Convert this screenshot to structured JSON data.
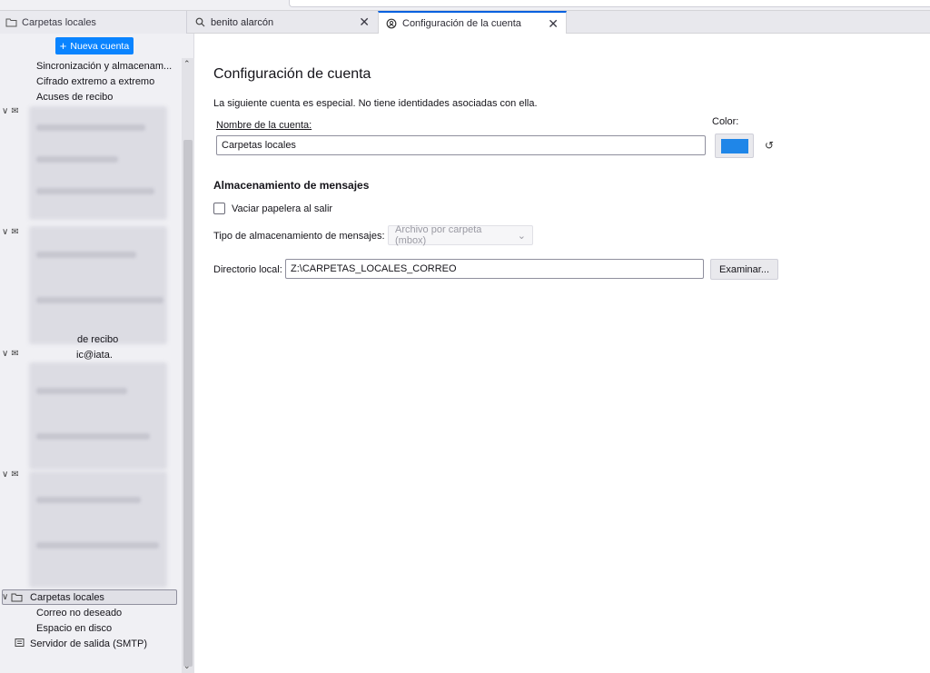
{
  "tabs": {
    "folder_pane_title": "Carpetas locales",
    "search_tab": "benito alarcón",
    "settings_tab": "Configuración de la cuenta"
  },
  "sidebar": {
    "new_account": "Nueva cuenta",
    "top_items": [
      "Sincronización y almacenam...",
      "Cifrado extremo a extremo",
      "Acuses de recibo"
    ],
    "partial_visible": [
      "de recibo",
      "ic@iata."
    ],
    "local_folders": "Carpetas locales",
    "local_children": [
      "Correo no deseado",
      "Espacio en disco"
    ],
    "smtp": "Servidor de salida (SMTP)"
  },
  "main": {
    "title": "Configuración de cuenta",
    "note": "La siguiente cuenta es especial. No tiene identidades asociadas con ella.",
    "account_name_label": "Nombre de la cuenta:",
    "account_name_value": "Carpetas locales",
    "color_label": "Color:",
    "color_value": "#1f86e8",
    "storage_heading": "Almacenamiento de mensajes",
    "empty_trash_label": "Vaciar papelera al salir",
    "storage_type_label": "Tipo de almacenamiento de mensajes:",
    "storage_type_value": "Archivo por carpeta (mbox)",
    "local_dir_label": "Directorio local:",
    "local_dir_value": "Z:\\CARPETAS_LOCALES_CORREO",
    "browse_button": "Examinar..."
  }
}
